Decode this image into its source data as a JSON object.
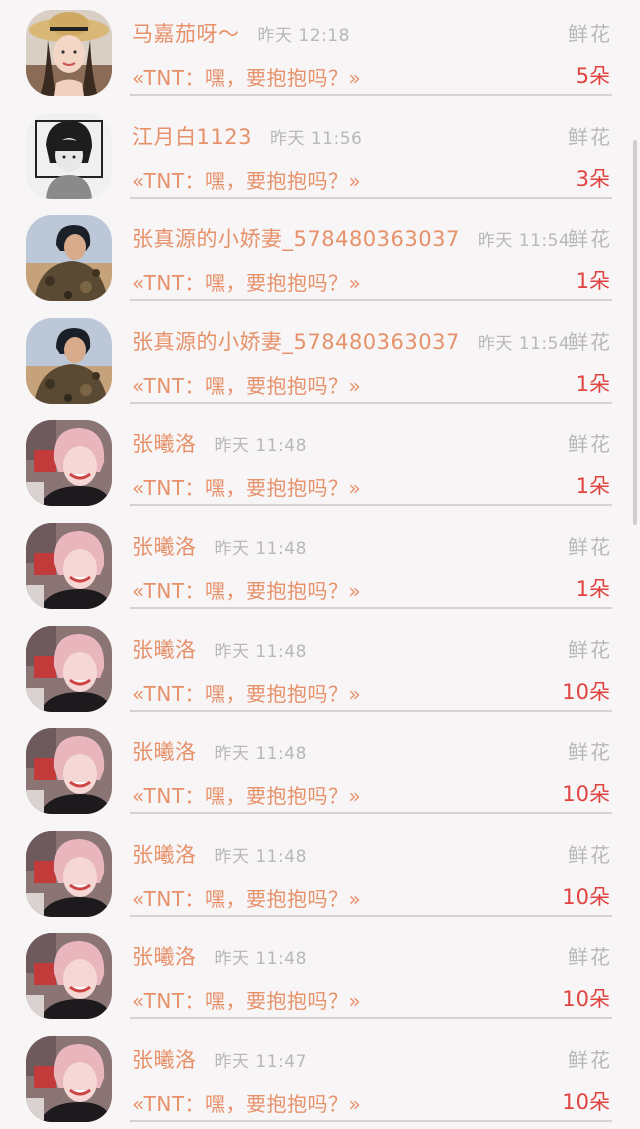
{
  "items": [
    {
      "name": "马嘉茄呀～",
      "time": "昨天 12:18",
      "gift": "鲜花",
      "message": "«TNT：嘿，要抱抱吗？»",
      "count": "5朵",
      "avatar": "woman-straw-hat"
    },
    {
      "name": "江月白1123",
      "time": "昨天 11:56",
      "gift": "鲜花",
      "message": "«TNT：嘿，要抱抱吗？»",
      "count": "3朵",
      "avatar": "sketch-boy"
    },
    {
      "name": "张真源的小娇妻_578480363037",
      "time": "昨天 11:54",
      "gift": "鲜花",
      "message": "«TNT：嘿，要抱抱吗？»",
      "count": "1朵",
      "avatar": "boy-camo-jacket"
    },
    {
      "name": "张真源的小娇妻_578480363037",
      "time": "昨天 11:54",
      "gift": "鲜花",
      "message": "«TNT：嘿，要抱抱吗？»",
      "count": "1朵",
      "avatar": "boy-camo-jacket"
    },
    {
      "name": "张曦洛",
      "time": "昨天 11:48",
      "gift": "鲜花",
      "message": "«TNT：嘿，要抱抱吗？»",
      "count": "1朵",
      "avatar": "pink-hair-smile"
    },
    {
      "name": "张曦洛",
      "time": "昨天 11:48",
      "gift": "鲜花",
      "message": "«TNT：嘿，要抱抱吗？»",
      "count": "1朵",
      "avatar": "pink-hair-smile"
    },
    {
      "name": "张曦洛",
      "time": "昨天 11:48",
      "gift": "鲜花",
      "message": "«TNT：嘿，要抱抱吗？»",
      "count": "10朵",
      "avatar": "pink-hair-smile"
    },
    {
      "name": "张曦洛",
      "time": "昨天 11:48",
      "gift": "鲜花",
      "message": "«TNT：嘿，要抱抱吗？»",
      "count": "10朵",
      "avatar": "pink-hair-smile"
    },
    {
      "name": "张曦洛",
      "time": "昨天 11:48",
      "gift": "鲜花",
      "message": "«TNT：嘿，要抱抱吗？»",
      "count": "10朵",
      "avatar": "pink-hair-smile"
    },
    {
      "name": "张曦洛",
      "time": "昨天 11:48",
      "gift": "鲜花",
      "message": "«TNT：嘿，要抱抱吗？»",
      "count": "10朵",
      "avatar": "pink-hair-smile"
    },
    {
      "name": "张曦洛",
      "time": "昨天 11:47",
      "gift": "鲜花",
      "message": "«TNT：嘿，要抱抱吗？»",
      "count": "10朵",
      "avatar": "pink-hair-smile"
    }
  ],
  "colors": {
    "name": "#e7916a",
    "count": "#e0423f",
    "muted": "#b9b7b8",
    "background": "#f7f5f6"
  }
}
